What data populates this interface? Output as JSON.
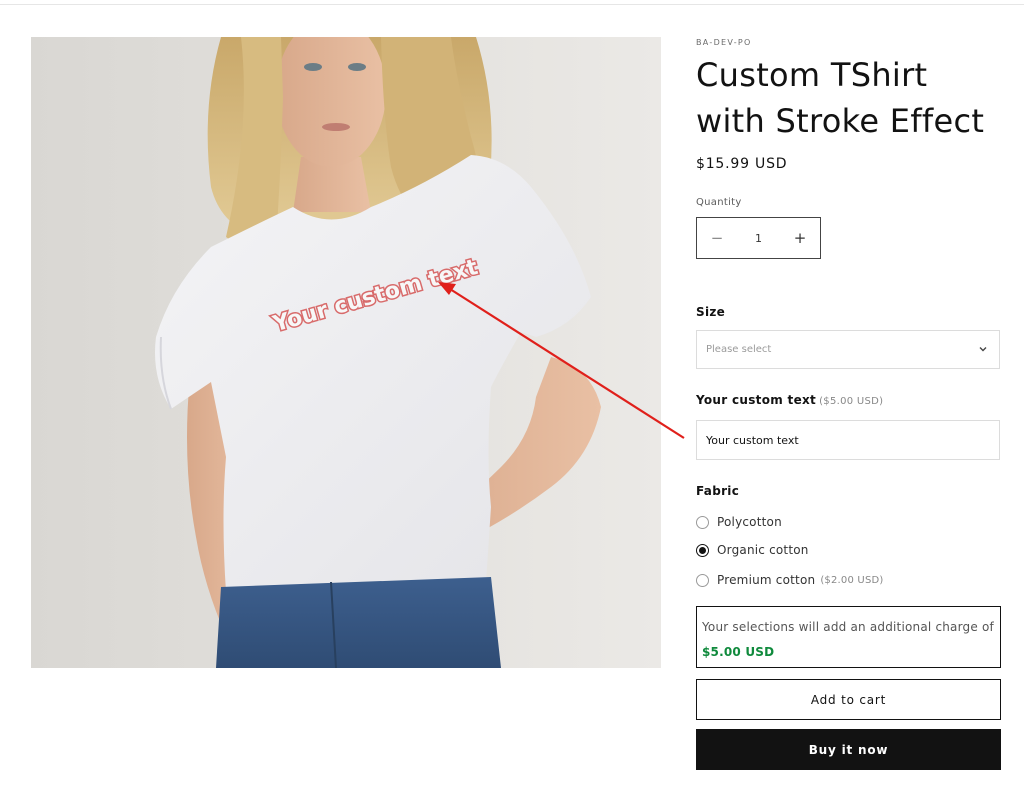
{
  "product": {
    "vendor": "BA-DEV-PO",
    "title": "Custom TShirt with Stroke Effect",
    "price": "$15.99 USD",
    "image_overlay_text": "Your custom text"
  },
  "quantity": {
    "label": "Quantity",
    "value": "1",
    "minus_icon": "minus-icon",
    "plus_icon": "plus-icon"
  },
  "size": {
    "label": "Size",
    "placeholder": "Please select",
    "icon": "chevron-down-icon"
  },
  "custom_text": {
    "label": "Your custom text",
    "price_note": "($5.00 USD)",
    "value": "Your custom text"
  },
  "fabric": {
    "label": "Fabric",
    "options": [
      {
        "label": "Polycotton",
        "note": "",
        "selected": false
      },
      {
        "label": "Organic cotton",
        "note": "",
        "selected": true
      },
      {
        "label": "Premium cotton",
        "note": "($2.00 USD)",
        "selected": false
      }
    ]
  },
  "charge_notice": {
    "text": "Your selections will add an additional charge of",
    "amount": "$5.00 USD",
    "amount_color": "#0f8a3c"
  },
  "buttons": {
    "add_to_cart": "Add to cart",
    "buy_now": "Buy it now"
  },
  "annotation": {
    "arrow_color": "#e0201b"
  }
}
